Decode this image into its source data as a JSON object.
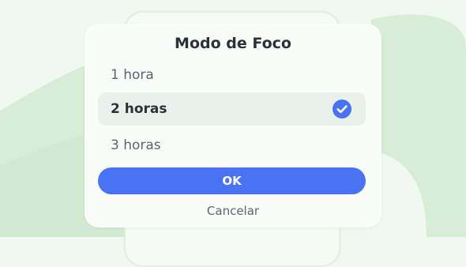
{
  "dialog": {
    "title": "Modo de Foco",
    "options": [
      {
        "label": "1 hora",
        "selected": false
      },
      {
        "label": "2 horas",
        "selected": true
      },
      {
        "label": "3 horas",
        "selected": false
      }
    ],
    "ok_label": "OK",
    "cancel_label": "Cancelar"
  },
  "colors": {
    "accent": "#4a73f3",
    "background": "#f1f7f1",
    "dialog_bg": "#f9fcf9",
    "selected_row_bg": "#eaf0ec",
    "decorative_green": "#d7edd6",
    "text_primary": "#2a3238",
    "text_secondary": "#5d6670"
  },
  "icons": {
    "selected_indicator": "check-circle-icon"
  }
}
